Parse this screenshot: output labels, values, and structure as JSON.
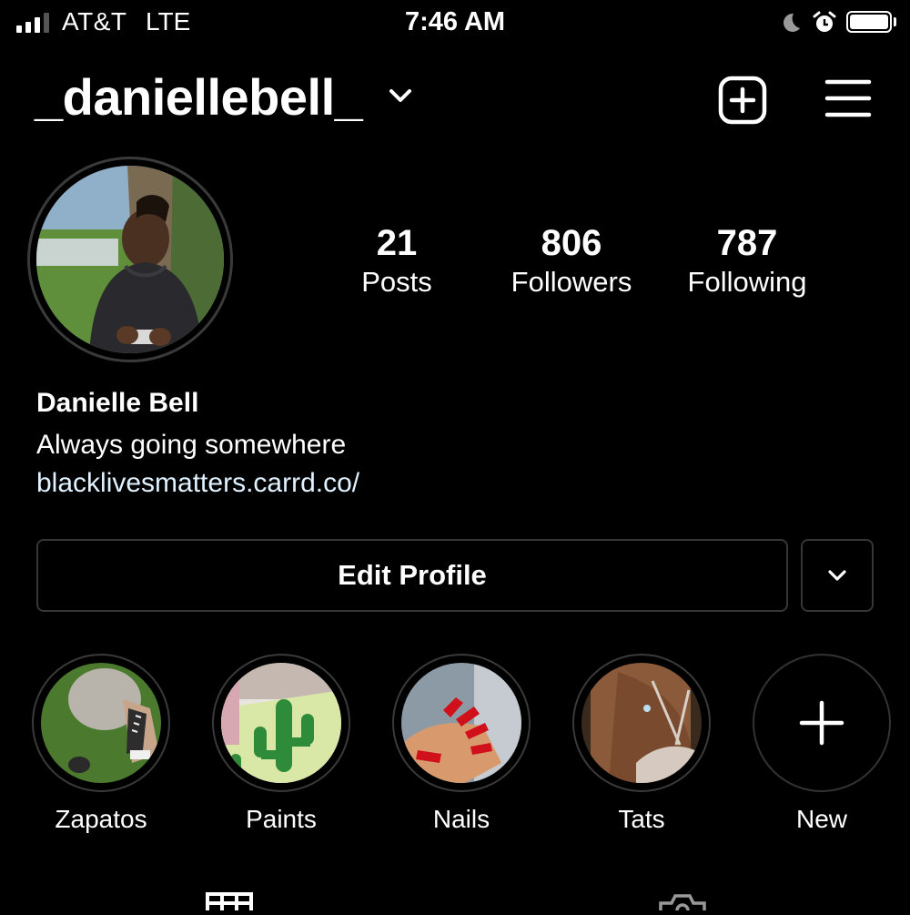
{
  "status_bar": {
    "carrier": "AT&T",
    "network": "LTE",
    "time": "7:46 AM",
    "icons": [
      "signal-icon",
      "moon-icon",
      "alarm-icon",
      "battery-icon"
    ]
  },
  "header": {
    "username": "_daniellebell_",
    "icons": [
      "chevron-down-icon",
      "plus-square-icon",
      "menu-icon"
    ]
  },
  "stats": [
    {
      "value": "21",
      "label": "Posts"
    },
    {
      "value": "806",
      "label": "Followers"
    },
    {
      "value": "787",
      "label": "Following"
    }
  ],
  "bio": {
    "name": "Danielle Bell",
    "text": "Always going somewhere",
    "link": "blacklivesmatters.carrd.co/"
  },
  "actions": {
    "edit_profile": "Edit Profile"
  },
  "highlights": [
    {
      "label": "Zapatos"
    },
    {
      "label": "Paints"
    },
    {
      "label": "Nails"
    },
    {
      "label": "Tats"
    },
    {
      "label": "New"
    }
  ],
  "tabs": [
    "grid-icon",
    "tagged-icon"
  ],
  "colors": {
    "background": "#000000",
    "text": "#ffffff",
    "link": "#e0f1ff",
    "border": "#363636"
  }
}
